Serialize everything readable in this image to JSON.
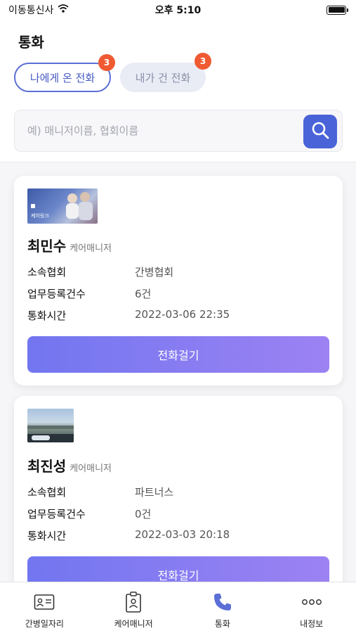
{
  "status_bar": {
    "carrier": "이동통신사",
    "time": "오후 5:10",
    "battery_level": 1.0
  },
  "header": {
    "title": "통화"
  },
  "tabs": [
    {
      "label": "나에게 온 전화",
      "badge": "3",
      "active": true
    },
    {
      "label": "내가 건 전화",
      "badge": "3",
      "active": false
    }
  ],
  "search": {
    "placeholder": "예) 매니저이름, 협회이름",
    "value": ""
  },
  "row_labels": {
    "association": "소속협회",
    "task_count": "업무등록건수",
    "call_time": "통화시간"
  },
  "cards": [
    {
      "name": "최민수",
      "role": "케어매니저",
      "association": "간병협회",
      "task_count": "6건",
      "call_time": "2022-03-06 22:35",
      "call_button": "전화걸기",
      "thumb_text": "케어링크"
    },
    {
      "name": "최진성",
      "role": "케어매니저",
      "association": "파트너스",
      "task_count": "0건",
      "call_time": "2022-03-03 20:18",
      "call_button": "전화걸기"
    }
  ],
  "bottom_nav": [
    {
      "label": "간병일자리",
      "icon": "id-card-icon",
      "active": false
    },
    {
      "label": "케어매니저",
      "icon": "badge-icon",
      "active": false
    },
    {
      "label": "통화",
      "icon": "phone-icon",
      "active": true
    },
    {
      "label": "내정보",
      "icon": "more-icon",
      "active": false
    }
  ],
  "colors": {
    "accent": "#4a63d8",
    "badge": "#f05a32",
    "button_start": "#7276f0",
    "button_end": "#9c82f3",
    "nav_active": "#5b6fd6"
  }
}
